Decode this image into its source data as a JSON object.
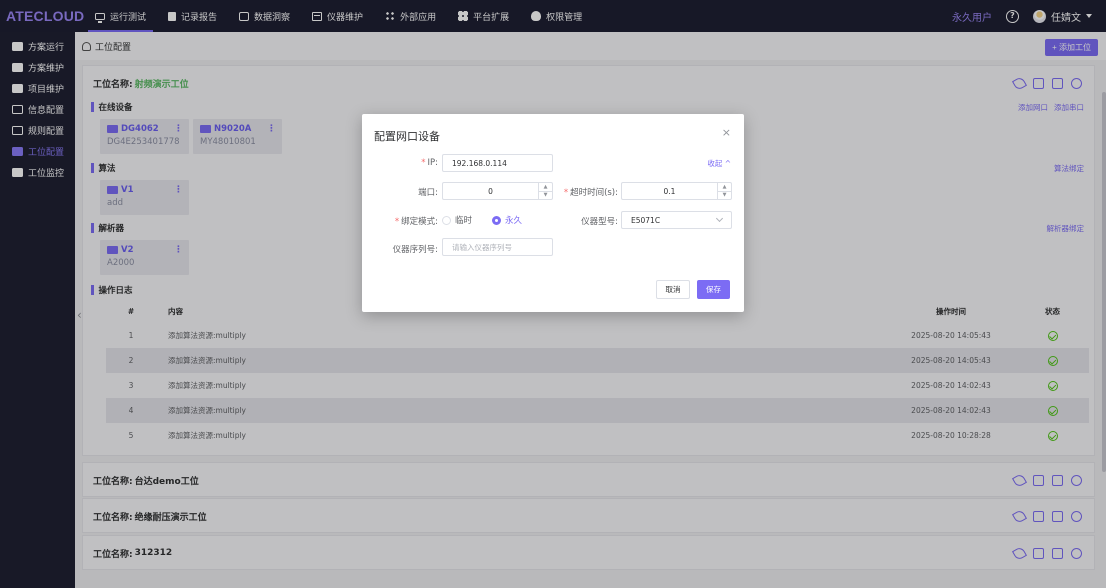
{
  "app": {
    "logo": "ATECLOUD"
  },
  "nav": [
    {
      "label": "运行测试",
      "icon": "monitor-icon",
      "active": true
    },
    {
      "label": "记录报告",
      "icon": "document-icon"
    },
    {
      "label": "数据洞察",
      "icon": "insight-icon"
    },
    {
      "label": "仪器维护",
      "icon": "instrument-icon"
    },
    {
      "label": "外部应用",
      "icon": "apps-icon"
    },
    {
      "label": "平台扩展",
      "icon": "extension-icon"
    },
    {
      "label": "权限管理",
      "icon": "permission-icon"
    }
  ],
  "header": {
    "user_link": "永久用户",
    "help": "?",
    "username": "任婧文"
  },
  "sidebar": [
    {
      "label": "方案运行",
      "icon": "folder-icon"
    },
    {
      "label": "方案维护",
      "icon": "folder-edit-icon"
    },
    {
      "label": "项目维护",
      "icon": "project-icon"
    },
    {
      "label": "信息配置",
      "icon": "info-config-icon"
    },
    {
      "label": "规则配置",
      "icon": "rule-icon"
    },
    {
      "label": "工位配置",
      "icon": "station-config-icon",
      "active": true
    },
    {
      "label": "工位监控",
      "icon": "station-monitor-icon"
    }
  ],
  "breadcrumb": {
    "text": "工位配置"
  },
  "toolbar": {
    "add_station": "+ 添加工位"
  },
  "station1": {
    "name_label": "工位名称:",
    "name_value": "射频演示工位",
    "online_devices": {
      "title": "在线设备",
      "links": [
        "添加网口",
        "添加串口"
      ],
      "devices": [
        {
          "name": "DG4062",
          "serial": "DG4E253401778"
        },
        {
          "name": "N9020A",
          "serial": "MY48010801"
        }
      ]
    },
    "algorithm": {
      "title": "算法",
      "link": "算法绑定",
      "items": [
        {
          "name": "V1",
          "sub": "add"
        }
      ]
    },
    "parser": {
      "title": "解析器",
      "link": "解析器绑定",
      "items": [
        {
          "name": "V2",
          "sub": "A2000"
        }
      ]
    },
    "log": {
      "title": "操作日志",
      "headers": {
        "index": "#",
        "content": "内容",
        "time": "操作时间",
        "status": "状态"
      },
      "rows": [
        {
          "index": "1",
          "content": "添加算法资源:multiply",
          "time": "2025-08-20 14:05:43"
        },
        {
          "index": "2",
          "content": "添加算法资源:multiply",
          "time": "2025-08-20 14:05:43"
        },
        {
          "index": "3",
          "content": "添加算法资源:multiply",
          "time": "2025-08-20 14:02:43"
        },
        {
          "index": "4",
          "content": "添加算法资源:multiply",
          "time": "2025-08-20 14:02:43"
        },
        {
          "index": "5",
          "content": "添加算法资源:multiply",
          "time": "2025-08-20 10:28:28"
        }
      ]
    }
  },
  "stations": [
    {
      "name_label": "工位名称:",
      "name_value": "台达demo工位"
    },
    {
      "name_label": "工位名称:",
      "name_value": "绝缘耐压演示工位"
    },
    {
      "name_label": "工位名称:",
      "name_value": "312312"
    }
  ],
  "modal": {
    "title": "配置网口设备",
    "close": "×",
    "collapse": "收起 ^",
    "ip_label": "IP:",
    "ip_value": "192.168.0.114",
    "port_label": "端口:",
    "port_value": "0",
    "timeout_label": "超时时间(s):",
    "timeout_value": "0.1",
    "bind_mode_label": "绑定模式:",
    "bind_mode_temp": "临时",
    "bind_mode_perm": "永久",
    "model_label": "仪器型号:",
    "model_value": "E5071C",
    "serial_label": "仪器序列号:",
    "serial_placeholder": "请输入仪器序列号",
    "cancel": "取消",
    "save": "保存"
  },
  "colors": {
    "accent": "#7c6cf4",
    "nav_bg": "#1e1f33",
    "success": "#52c41a",
    "highlight": "#5bb865"
  }
}
